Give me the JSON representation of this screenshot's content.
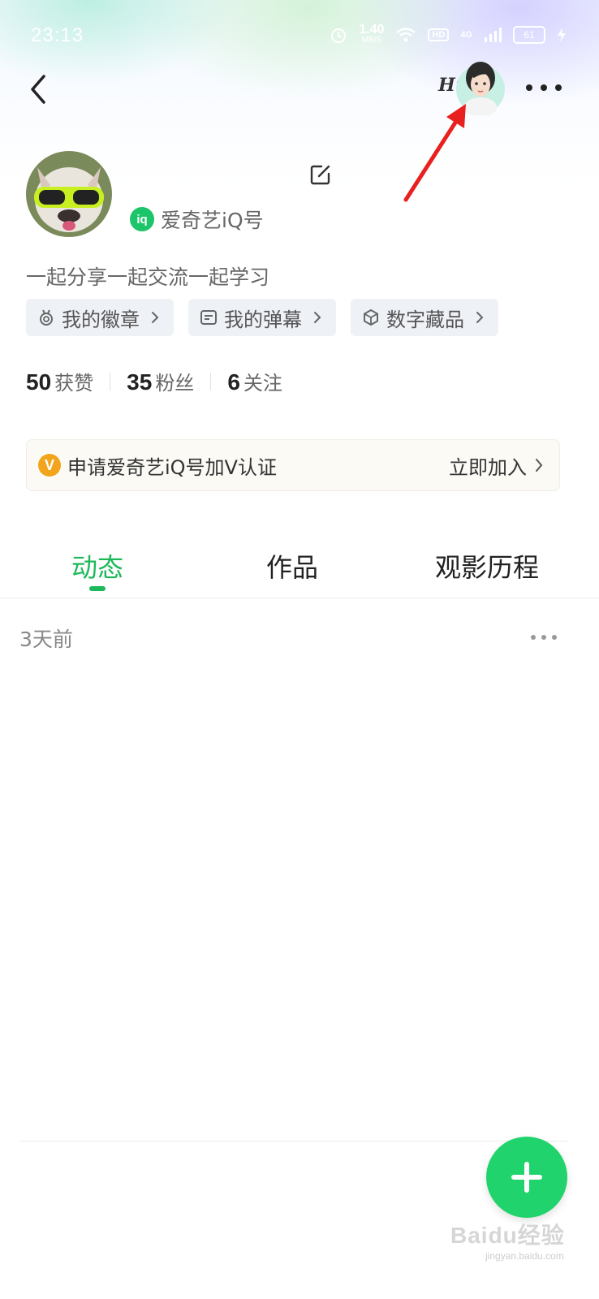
{
  "status_bar": {
    "time": "23:13",
    "net_speed_value": "1.40",
    "net_speed_unit": "MB/S",
    "hd": "HD",
    "signal": "4G",
    "battery": "61"
  },
  "header": {
    "greeting": "Hi",
    "icons": {
      "back": "back-chevron-icon",
      "more": "more-dots-icon",
      "assistant": "assistant-avatar"
    }
  },
  "profile": {
    "account_type": "爱奇艺iQ号",
    "bio": "一起分享一起交流一起学习",
    "chips": [
      {
        "label": "我的徽章",
        "icon": "badge-icon"
      },
      {
        "label": "我的弹幕",
        "icon": "danmaku-icon"
      },
      {
        "label": "数字藏品",
        "icon": "cube-icon"
      }
    ],
    "stats": [
      {
        "value": "50",
        "label": "获赞"
      },
      {
        "value": "35",
        "label": "粉丝"
      },
      {
        "value": "6",
        "label": "关注"
      }
    ]
  },
  "verify_banner": {
    "badge": "V",
    "text": "申请爱奇艺iQ号加V认证",
    "action": "立即加入"
  },
  "tabs": [
    {
      "label": "动态",
      "active": true
    },
    {
      "label": "作品",
      "active": false
    },
    {
      "label": "观影历程",
      "active": false
    }
  ],
  "feed": {
    "post_time": "3天前"
  },
  "watermark": {
    "text": "Baidu经验",
    "sub": "jingyan.baidu.com"
  },
  "colors": {
    "accent": "#1cb85a",
    "fab": "#21d36c",
    "v_badge": "#f2a51c"
  }
}
